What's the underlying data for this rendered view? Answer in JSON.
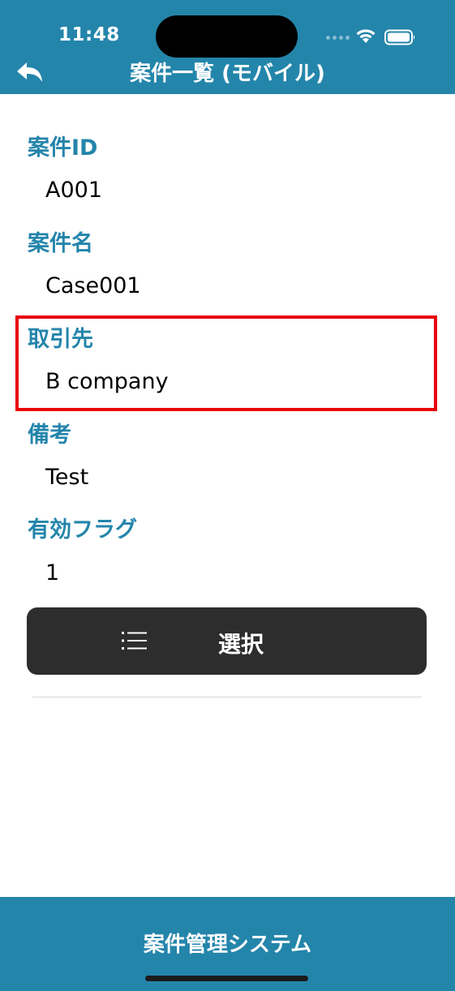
{
  "status_bar": {
    "time": "11:48"
  },
  "nav": {
    "title": "案件一覧 (モバイル)",
    "back_icon": "back-arrow-icon"
  },
  "fields": [
    {
      "label": "案件ID",
      "value": "A001"
    },
    {
      "label": "案件名",
      "value": "Case001"
    },
    {
      "label": "取引先",
      "value": "B company",
      "highlighted": true
    },
    {
      "label": "備考",
      "value": "Test"
    },
    {
      "label": "有効フラグ",
      "value": "1"
    }
  ],
  "select_button": {
    "label": "選択",
    "icon": "list-icon"
  },
  "footer": {
    "title": "案件管理システム"
  },
  "colors": {
    "header_bg": "#2485ab",
    "label_text": "#2485ab",
    "button_bg": "#2d2d2d",
    "highlight_border": "#e8000b"
  }
}
